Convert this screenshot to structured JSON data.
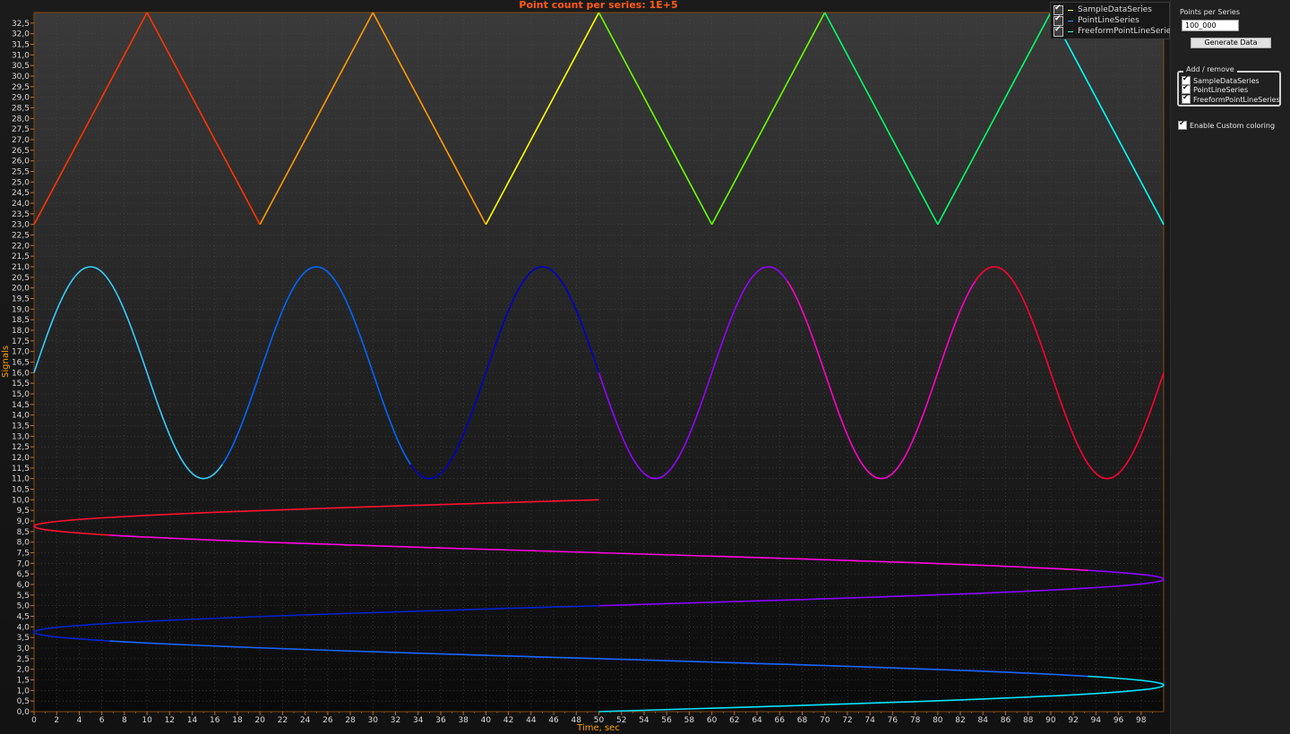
{
  "chart_data": {
    "type": "line",
    "title": "Point count per series: 1E+5",
    "xlabel": "Time, sec",
    "ylabel": "Signals",
    "xlim": [
      0,
      100
    ],
    "ylim": [
      0,
      33
    ],
    "x_ticks": [
      0,
      2,
      4,
      6,
      8,
      10,
      12,
      14,
      16,
      18,
      20,
      22,
      24,
      26,
      28,
      30,
      32,
      34,
      36,
      38,
      40,
      42,
      44,
      46,
      48,
      50,
      52,
      54,
      56,
      58,
      60,
      62,
      64,
      66,
      68,
      70,
      72,
      74,
      76,
      78,
      80,
      82,
      84,
      86,
      88,
      90,
      92,
      94,
      96,
      98
    ],
    "y_ticks": [
      "0,0",
      "0,5",
      "1,0",
      "1,5",
      "2,0",
      "2,5",
      "3,0",
      "3,5",
      "4,0",
      "4,5",
      "5,0",
      "5,5",
      "6,0",
      "6,5",
      "7,0",
      "7,5",
      "8,0",
      "8,5",
      "9,0",
      "9,5",
      "10,0",
      "10,5",
      "11,0",
      "11,5",
      "12,0",
      "12,5",
      "13,0",
      "13,5",
      "14,0",
      "14,5",
      "15,0",
      "15,5",
      "16,0",
      "16,5",
      "17,0",
      "17,5",
      "18,0",
      "18,5",
      "19,0",
      "19,5",
      "20,0",
      "20,5",
      "21,0",
      "21,5",
      "22,0",
      "22,5",
      "23,0",
      "23,5",
      "24,0",
      "24,5",
      "25,0",
      "25,5",
      "26,0",
      "26,5",
      "27,0",
      "27,5",
      "28,0",
      "28,5",
      "29,0",
      "29,5",
      "30,0",
      "30,5",
      "31,0",
      "31,5",
      "32,0",
      "32,5"
    ],
    "grid": true,
    "legend_position": "top-right",
    "series": [
      {
        "name": "SampleDataSeries",
        "kind": "triangle",
        "points": [
          [
            0,
            23
          ],
          [
            10,
            33
          ],
          [
            20,
            23
          ],
          [
            30,
            33
          ],
          [
            40,
            23
          ],
          [
            50,
            33
          ],
          [
            60,
            23
          ],
          [
            70,
            33
          ],
          [
            80,
            23
          ],
          [
            90,
            33
          ],
          [
            100,
            23
          ]
        ],
        "colors": [
          "#ff3300",
          "#ff9900",
          "#ffff00",
          "#66ff00",
          "#00ff66",
          "#00ffff"
        ]
      },
      {
        "name": "PointLineSeries",
        "kind": "sine",
        "offset": 16,
        "amplitude": 5,
        "period": 20,
        "x_range": [
          0,
          100
        ],
        "colors": [
          "#33ccff",
          "#0066ff",
          "#0000cc",
          "#9900ff",
          "#ff00cc",
          "#ff0033"
        ]
      },
      {
        "name": "FreeformPointLineSeries",
        "kind": "freeform-spiral",
        "y_range": [
          0,
          10
        ],
        "x_center": 50,
        "x_amplitude": 50,
        "y_period": 5,
        "colors": [
          "#00e5ff",
          "#1a66ff",
          "#0022cc",
          "#8800ff",
          "#ff00dd",
          "#ff1133"
        ]
      }
    ]
  },
  "legend": {
    "items": [
      {
        "label": "SampleDataSeries",
        "color": "#ffff66"
      },
      {
        "label": "PointLineSeries",
        "color": "#3388ff"
      },
      {
        "label": "FreeformPointLineSeries",
        "color": "#33ffcc"
      }
    ]
  },
  "side_panel": {
    "points_label": "Points per Series",
    "points_value": "100_000",
    "generate_label": "Generate Data",
    "add_remove_title": "Add / remove",
    "checks": [
      "SampleDataSeries",
      "PointLineSeries",
      "FreeformPointLineSeries"
    ],
    "custom_coloring_label": "Enable Custom coloring"
  }
}
